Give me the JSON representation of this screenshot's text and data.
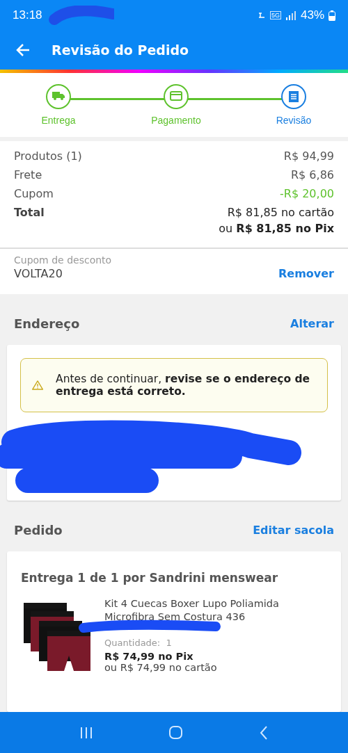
{
  "status_bar": {
    "time": "13:18",
    "network": "5G",
    "battery": "43%"
  },
  "app_bar": {
    "title": "Revisão do Pedido"
  },
  "stepper": [
    {
      "label": "Entrega",
      "kind": "truck",
      "completed": true
    },
    {
      "label": "Pagamento",
      "kind": "card",
      "completed": true
    },
    {
      "label": "Revisão",
      "kind": "document",
      "completed": false
    }
  ],
  "summary": [
    {
      "label": "Produtos (1)",
      "value": "R$ 94,99",
      "kind": "plain"
    },
    {
      "label": "Frete",
      "value": "R$ 6,86",
      "kind": "plain"
    },
    {
      "label": "Cupom",
      "value": "-R$ 20,00",
      "kind": "discount"
    }
  ],
  "total": {
    "label": "Total",
    "card": "R$ 81,85 no cartão",
    "pix": "ou **R$ 81,85 no Pix**"
  },
  "coupon": {
    "label": "Cupom de desconto",
    "code": "VOLTA20",
    "action": "Remover"
  },
  "address": {
    "title": "Endereço",
    "action": "Alterar",
    "warning": "Antes de continuar, **revise se o endereço de entrega está correto.**"
  },
  "order": {
    "title": "Pedido",
    "action": "Editar sacola",
    "shipment": "Entrega 1 de 1 por Sandrini menswear",
    "item": {
      "kind": "picture",
      "name": "Kit 4 Cuecas Boxer Lupo Poliamida Microfibra Sem Costura 436",
      "quantity_label": "Quantidade:",
      "quantity": "1",
      "pix_price": "R$ 74,99 no Pix",
      "card_price": "ou R$ 74,99 no cartão"
    }
  }
}
